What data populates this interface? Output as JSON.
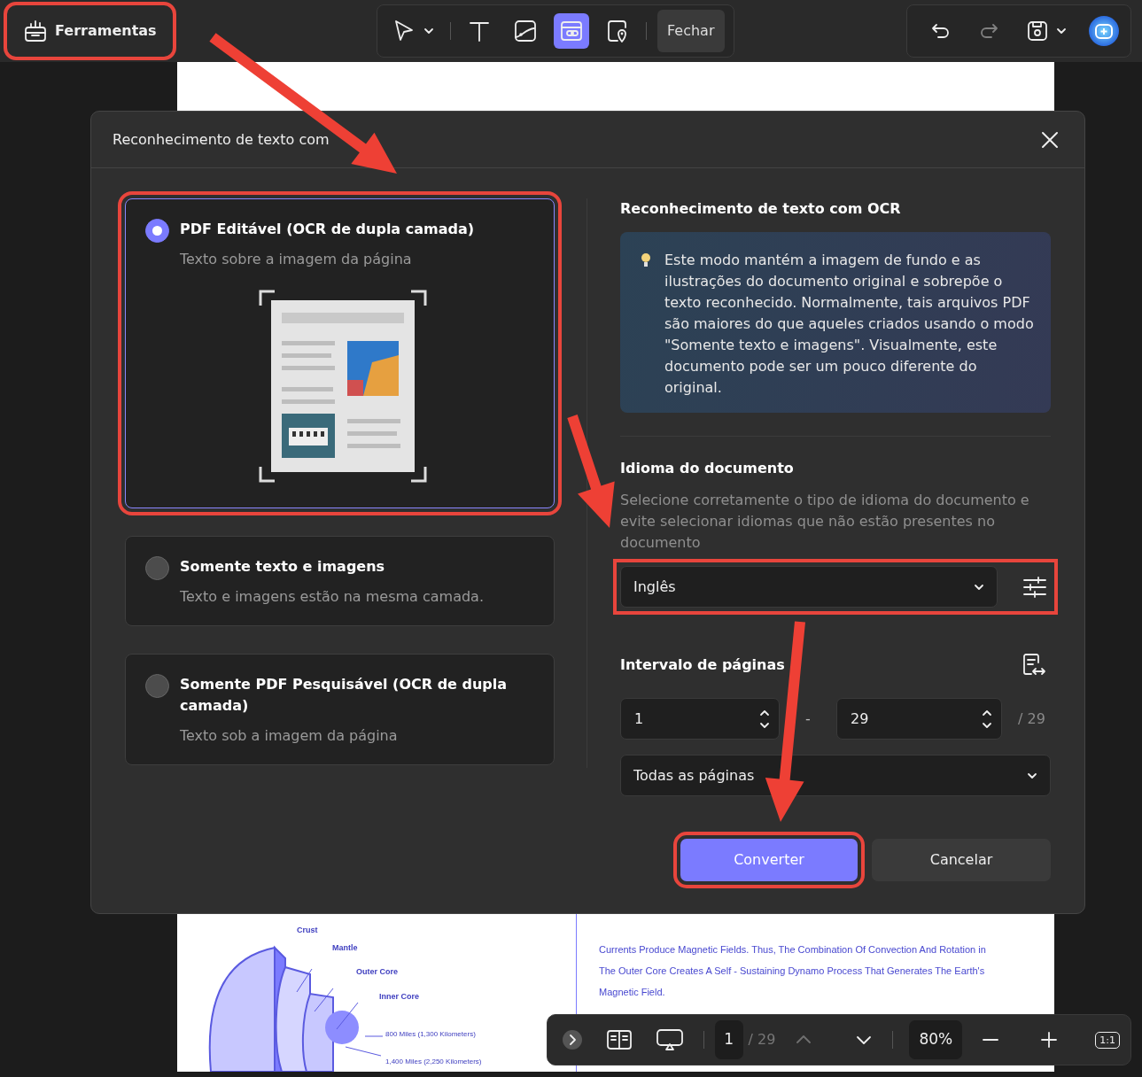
{
  "toolbar": {
    "tools_button": {
      "label": "Ferramentas",
      "highlighted": true
    },
    "tools": [
      {
        "kind": "pointer",
        "selected": false
      },
      {
        "kind": "text",
        "selected": false
      },
      {
        "kind": "image",
        "selected": false
      },
      {
        "kind": "link",
        "selected": true
      },
      {
        "kind": "pin",
        "selected": false
      }
    ],
    "close_button": "Fechar",
    "redo_disabled": true
  },
  "dialog": {
    "title": "Reconhecimento de texto com",
    "options": [
      {
        "title": "PDF Editável (OCR de dupla camada)",
        "description": "Texto sobre a imagem da página",
        "selected": true,
        "highlighted": true
      },
      {
        "title": "Somente texto e imagens",
        "description": "Texto e imagens estão na mesma camada.",
        "selected": false,
        "highlighted": false
      },
      {
        "title": "Somente PDF Pesquisável (OCR de dupla camada)",
        "description": "Texto sob a imagem da página",
        "selected": false,
        "highlighted": false
      }
    ],
    "info_heading": "Reconhecimento de texto com OCR",
    "info_text": "Este modo mantém a imagem de fundo e as ilustrações do documento original e sobrepõe o texto reconhecido. Normalmente, tais arquivos PDF são maiores do que aqueles criados usando o modo \"Somente texto e imagens\". Visualmente, este documento pode ser um pouco diferente do original.",
    "language": {
      "heading": "Idioma do documento",
      "description": "Selecione corretamente o tipo de idioma do documento e evite selecionar idiomas que não estão presentes no documento",
      "value": "Inglês",
      "highlighted": true
    },
    "page_range": {
      "heading": "Intervalo de páginas",
      "from": "1",
      "separator": "-",
      "to": "29",
      "total": "/ 29",
      "scope": "Todas as páginas"
    },
    "buttons": [
      {
        "label": "Converter",
        "kind": "primary",
        "highlighted": true
      },
      {
        "label": "Cancelar",
        "kind": "secondary",
        "highlighted": false
      }
    ]
  },
  "document": {
    "diagram_labels": [
      "Crust",
      "Mantle",
      "Outer Core",
      "Inner Core",
      "800 Miles (1,300 Kilometers)",
      "1,400 Miles (2,250 Kilometers)"
    ],
    "paragraph_lines": [
      "Currents Produce Magnetic Fields. Thus, The Combination Of Convection And Rotation in",
      "The Outer Core Creates A Self - Sustaining Dynamo Process That Generates The Earth's",
      "Magnetic Field."
    ]
  },
  "bottom_bar": {
    "page": "1",
    "total": "/ 29",
    "zoom": "80%",
    "fit_label": "1:1",
    "prev_disabled": true
  }
}
